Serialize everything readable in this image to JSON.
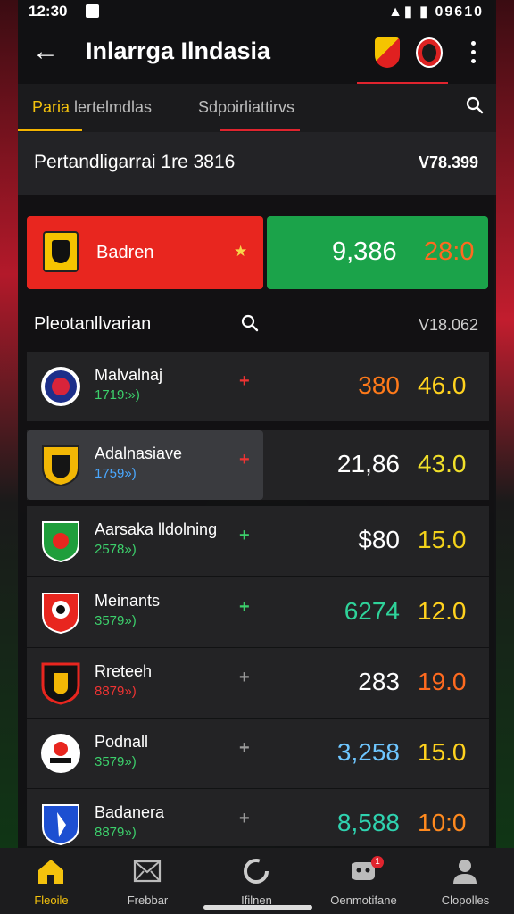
{
  "status_bar": {
    "time": "12:30",
    "battery_text": "09610"
  },
  "app_bar": {
    "title": "Inlarrga Ilndasia"
  },
  "tabs": [
    {
      "label_highlight": "Paria",
      "label_rest": " lertelmdlas"
    },
    {
      "label": "Sdpoirliattirvs"
    }
  ],
  "header_row": {
    "label": "Pertandligarrai 1re 3816",
    "value": "V78.399"
  },
  "featured": {
    "team": "Badren",
    "score_a": "9,386",
    "score_b": "28:0",
    "colors": {
      "left": "#e8261f",
      "right": "#1ba34a"
    }
  },
  "list": {
    "title": "Pleotanllvarian",
    "value": "V18.062",
    "rows": [
      {
        "name": "Malvalnaj",
        "sub": "1719:»)",
        "sub_color": "#3ccf6b",
        "sign": "+",
        "sign_color": "#e33",
        "value1": "380",
        "value1_color": "#ff7a1a",
        "value2": "46.0",
        "value2_color": "#ffd21e"
      },
      {
        "name": "Adalnasiave",
        "sub": "1759»)",
        "sub_color": "#4aa8ff",
        "sign": "+",
        "sign_color": "#e33",
        "value1": "21,86",
        "value1_color": "#ffffff",
        "value2": "43.0",
        "value2_color": "#f1e02a"
      },
      {
        "name": "Aarsaka lldolning",
        "sub": "2578»)",
        "sub_color": "#3ccf6b",
        "sign": "+",
        "sign_color": "#3ccf6b",
        "value1": "$80",
        "value1_color": "#ffffff",
        "value2": "15.0",
        "value2_color": "#f3d21a"
      },
      {
        "name": "Meinants",
        "sub": "3579»)",
        "sub_color": "#3ccf6b",
        "sign": "+",
        "sign_color": "#3ccf6b",
        "value1": "6274",
        "value1_color": "#2fd39a",
        "value2": "12.0",
        "value2_color": "#ffd21e"
      },
      {
        "name": "Rreteeh",
        "sub": "8879»)",
        "sub_color": "#e33",
        "sign": "+",
        "sign_color": "#9a9a9a",
        "value1": "283",
        "value1_color": "#ffffff",
        "value2": "19.0",
        "value2_color": "#ff6a1f"
      },
      {
        "name": "Podnall",
        "sub": "3579»)",
        "sub_color": "#3ccf6b",
        "sign": "+",
        "sign_color": "#9a9a9a",
        "value1": "3,258",
        "value1_color": "#6ec6ff",
        "value2": "15.0",
        "value2_color": "#ffd21e"
      },
      {
        "name": "Badanera",
        "sub": "8879»)",
        "sub_color": "#3ccf6b",
        "sign": "+",
        "sign_color": "#9a9a9a",
        "value1": "8,588",
        "value1_color": "#2fd3b0",
        "value2": "10:0",
        "value2_color": "#ff8a1f"
      }
    ]
  },
  "bottom_nav": [
    {
      "label": "Fleoile",
      "icon": "home-icon",
      "active": true
    },
    {
      "label": "Frebbar",
      "icon": "mail-icon",
      "active": false
    },
    {
      "label": "Ifilnen",
      "icon": "refresh-icon",
      "active": false
    },
    {
      "label": "Oenmotifane",
      "icon": "chat-icon",
      "active": false,
      "badge": "1"
    },
    {
      "label": "Clopolles",
      "icon": "user-icon",
      "active": false
    }
  ],
  "accent_colors": {
    "red": "#e0242e",
    "yellow": "#f4b400",
    "green": "#1ba34a"
  }
}
